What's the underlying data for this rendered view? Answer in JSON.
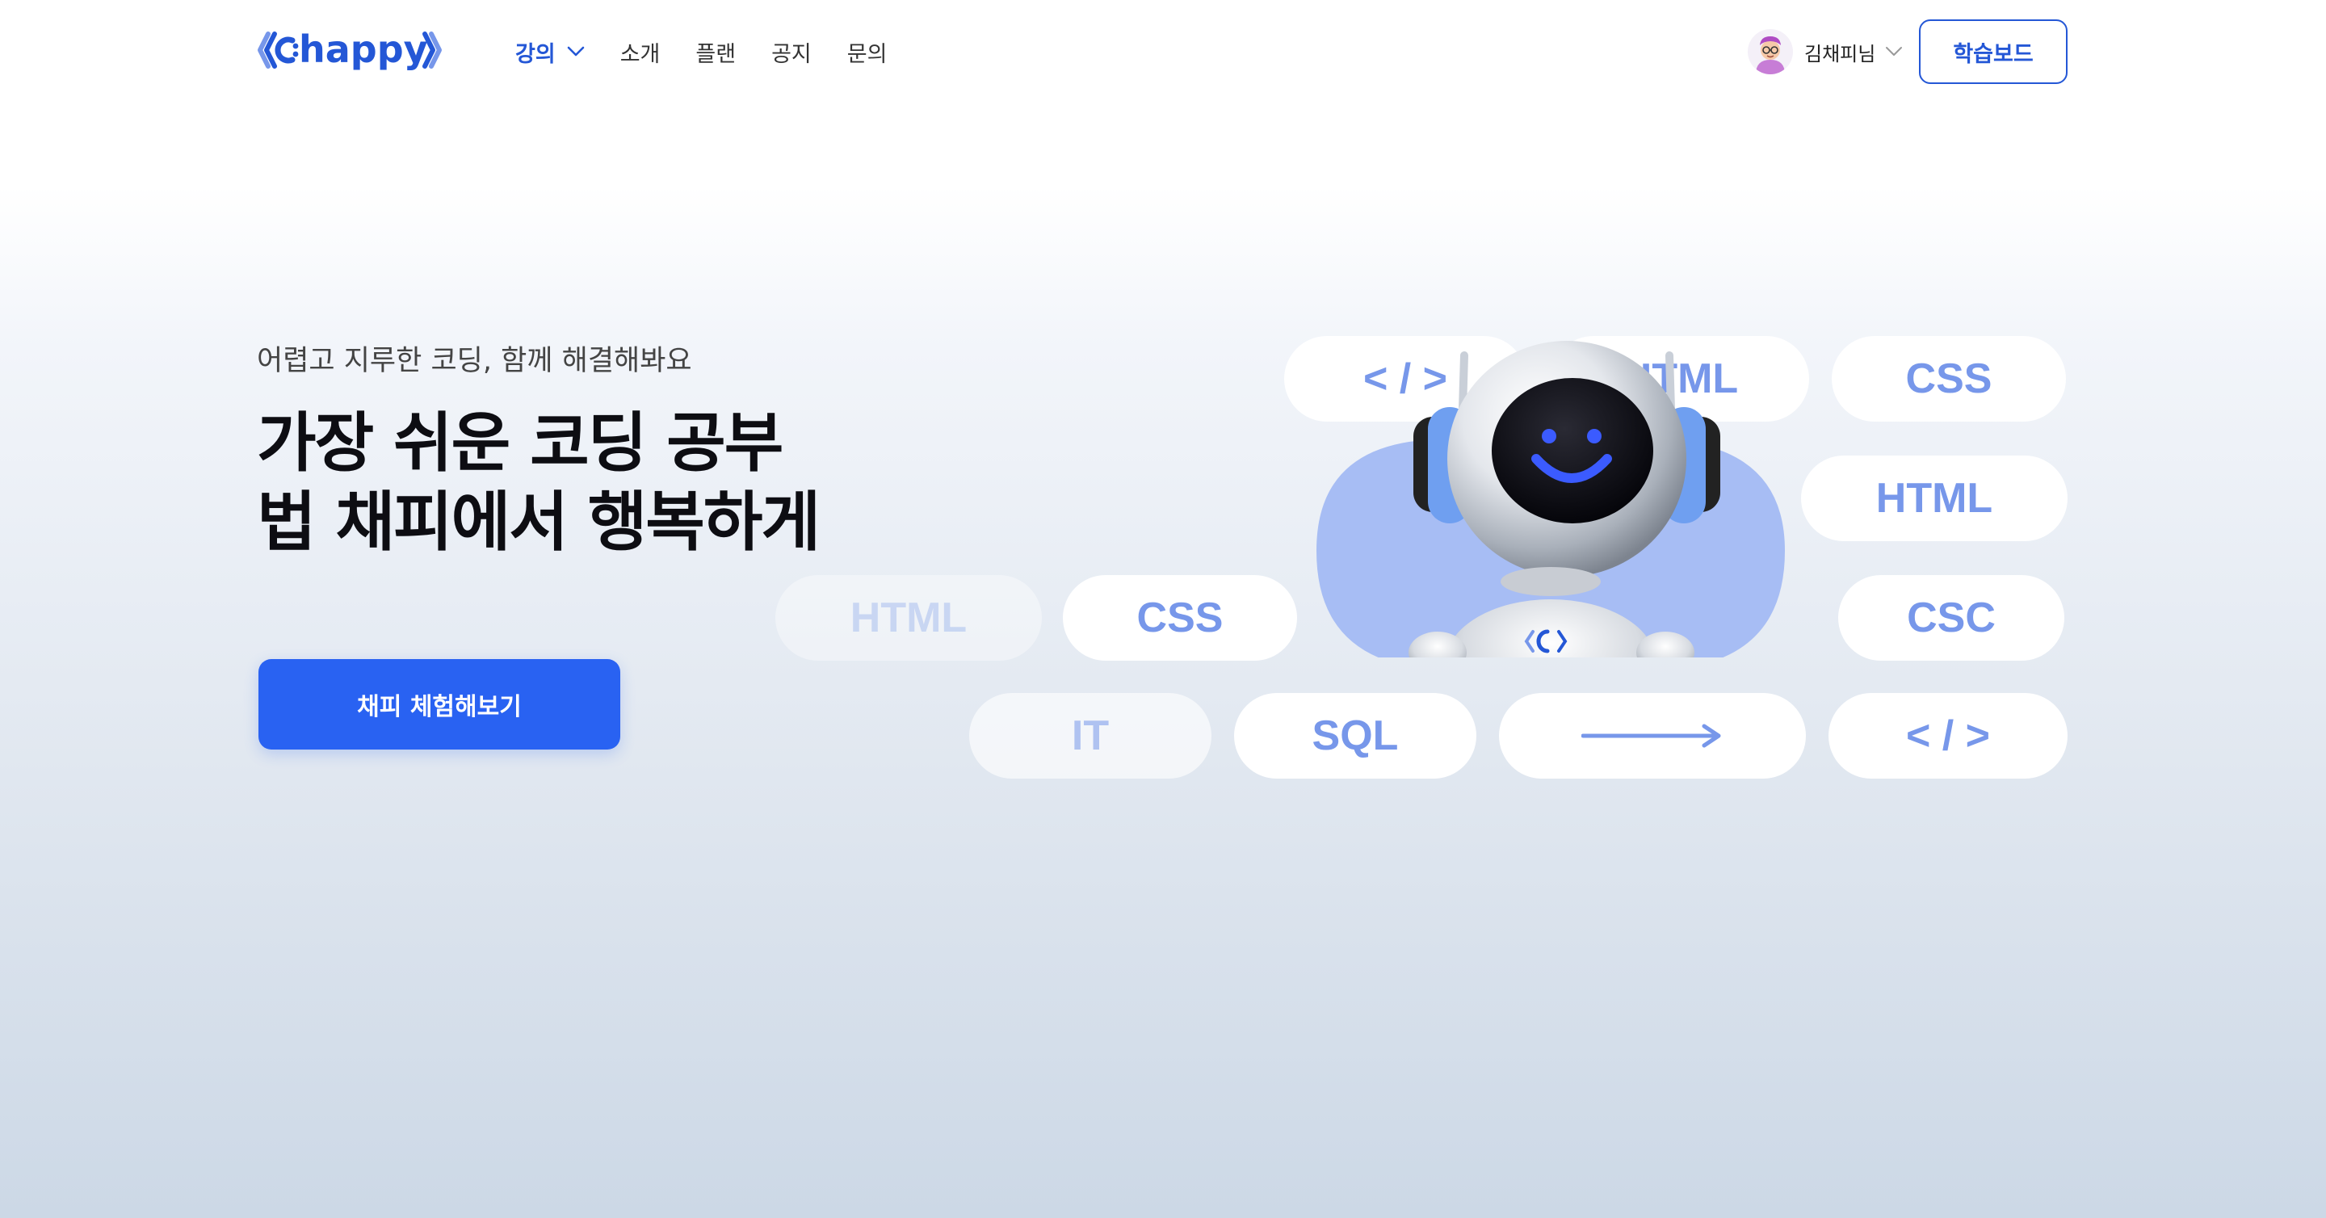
{
  "brand": {
    "logo_text": "happy",
    "accent": "#2962f2",
    "logo_color": "#2457d6"
  },
  "nav": {
    "items": [
      {
        "label": "강의",
        "active": true,
        "has_dropdown": true
      },
      {
        "label": "소개"
      },
      {
        "label": "플랜"
      },
      {
        "label": "공지"
      },
      {
        "label": "문의"
      }
    ]
  },
  "user": {
    "name": "김채피님",
    "avatar_icon": "user-avatar"
  },
  "header": {
    "dashboard_label": "학습보드"
  },
  "hero": {
    "subtitle": "어렵고 지루한 코딩, 함께 해결해봐요",
    "title_line1": "가장 쉬운 코딩 공부",
    "title_line2": "법 채피에서 행복하게",
    "cta_label": "채피 체험해보기"
  },
  "pills": {
    "row1": [
      "< / >",
      "HTML",
      "CSS"
    ],
    "row2": [
      "HTML"
    ],
    "row3": [
      "HTML",
      "CSS",
      "CSC"
    ],
    "row4": [
      "IT",
      "SQL",
      "arrow-right-icon",
      "< / >"
    ]
  }
}
